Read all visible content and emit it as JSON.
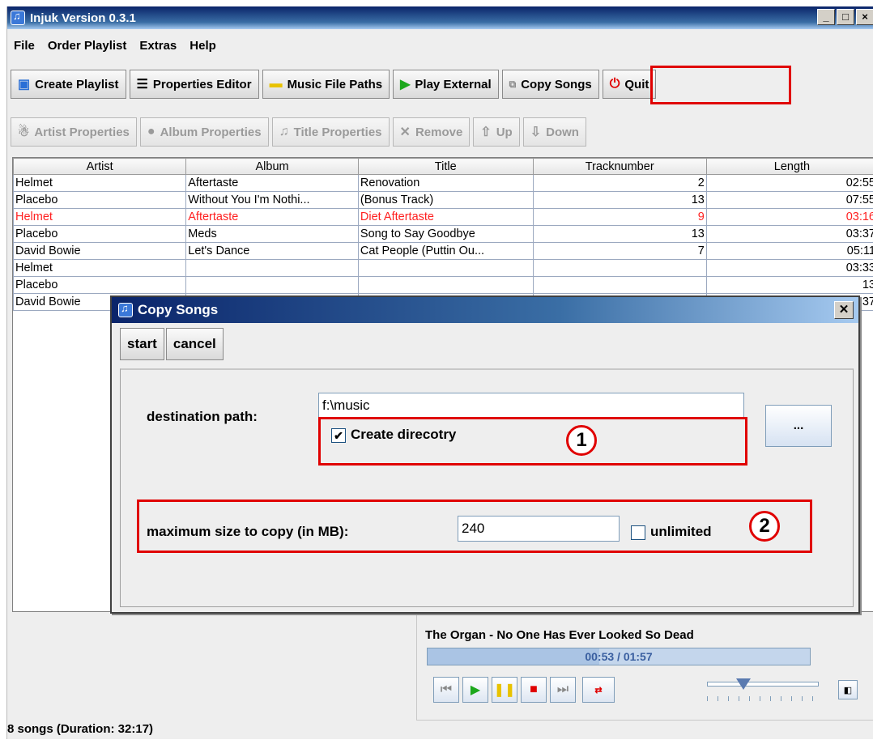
{
  "window": {
    "title": "Injuk Version 0.3.1",
    "buttons": [
      "_",
      "□",
      "×"
    ]
  },
  "menu": [
    "File",
    "Order Playlist",
    "Extras",
    "Help"
  ],
  "toolbar": [
    {
      "label": "Create Playlist",
      "icon": "playlist-icon"
    },
    {
      "label": "Properties Editor",
      "icon": "list-icon"
    },
    {
      "label": "Music File Paths",
      "icon": "folder-icon"
    },
    {
      "label": "Play External",
      "icon": "play-icon"
    },
    {
      "label": "Copy Songs",
      "icon": "copy-icon"
    },
    {
      "label": "Quit",
      "icon": "power-icon"
    }
  ],
  "toolbar2": [
    {
      "label": "Artist Properties",
      "icon": "person-icon"
    },
    {
      "label": "Album Properties",
      "icon": "disc-icon"
    },
    {
      "label": "Title Properties",
      "icon": "note-icon"
    },
    {
      "label": "Remove",
      "icon": "x-icon"
    },
    {
      "label": "Up",
      "icon": "arrow-up-icon"
    },
    {
      "label": "Down",
      "icon": "arrow-down-icon"
    }
  ],
  "table": {
    "columns": [
      "Artist",
      "Album",
      "Title",
      "Tracknumber",
      "Length"
    ],
    "rows": [
      {
        "artist": "Helmet",
        "album": "Aftertaste",
        "title": "Renovation",
        "track": "2",
        "length": "02:55",
        "highlight": false
      },
      {
        "artist": "Placebo",
        "album": "Without You I'm Nothi...",
        "title": "(Bonus Track)",
        "track": "13",
        "length": "07:55",
        "highlight": false
      },
      {
        "artist": "Helmet",
        "album": "Aftertaste",
        "title": "Diet Aftertaste",
        "track": "9",
        "length": "03:16",
        "highlight": true
      },
      {
        "artist": "Placebo",
        "album": "Meds",
        "title": "Song to Say Goodbye",
        "track": "13",
        "length": "03:37",
        "highlight": false
      },
      {
        "artist": "David Bowie",
        "album": "Let's Dance",
        "title": "Cat People (Puttin Ou...",
        "track": "7",
        "length": "05:11",
        "highlight": false
      },
      {
        "artist": "Helmet",
        "album": "",
        "title": "",
        "track": "",
        "length": "03:33",
        "highlight": false
      },
      {
        "artist": "Placebo",
        "album": "",
        "title": "",
        "track": "",
        "length": "13",
        "highlight": false
      },
      {
        "artist": "David Bowie",
        "album": "",
        "title": "",
        "track": "",
        "length": "37",
        "highlight": false
      }
    ]
  },
  "player": {
    "song": "The Organ - No One Has Ever Looked So Dead",
    "time": "00:53 / 01:57",
    "progress": 0.45,
    "volume": 0.3
  },
  "status": "8 songs (Duration: 32:17)",
  "dialog": {
    "title": "Copy Songs",
    "start": "start",
    "cancel": "cancel",
    "destination_label": "destination path:",
    "destination_value": "f:\\music",
    "create_dir_label": "Create direcotry",
    "create_dir_checked": true,
    "browse": "...",
    "max_label": "maximum size to copy (in MB):",
    "max_value": "240",
    "unlimited_label": "unlimited",
    "unlimited_checked": false,
    "annot1": "1",
    "annot2": "2"
  },
  "colors": {
    "highlight_row": "#ff2020",
    "annotation": "#e00000"
  }
}
